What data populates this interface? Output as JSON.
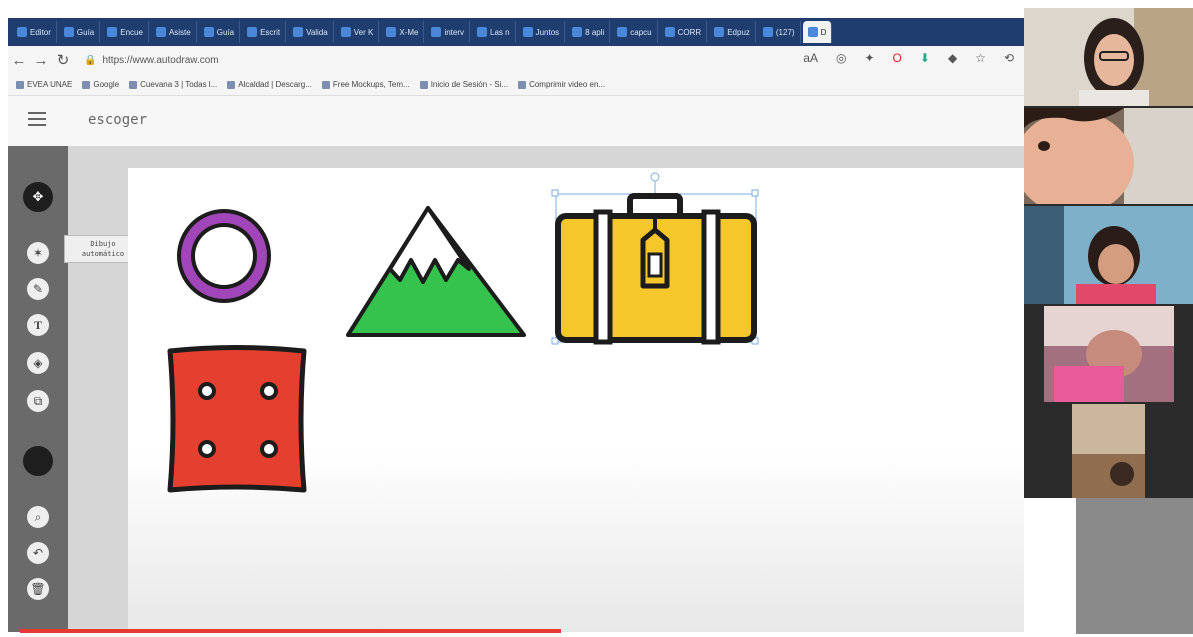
{
  "browser": {
    "tabs": [
      {
        "label": "Editor"
      },
      {
        "label": "Guía"
      },
      {
        "label": "Encue"
      },
      {
        "label": "Asiste"
      },
      {
        "label": "Guía"
      },
      {
        "label": "Escrit"
      },
      {
        "label": "Valida"
      },
      {
        "label": "Ver K"
      },
      {
        "label": "X-Me"
      },
      {
        "label": "interv"
      },
      {
        "label": "Las n"
      },
      {
        "label": "Juntos"
      },
      {
        "label": "8 apli"
      },
      {
        "label": "capcu"
      },
      {
        "label": "CORR"
      },
      {
        "label": "Edpuz"
      },
      {
        "label": "(127)"
      },
      {
        "label": "D"
      }
    ],
    "url": "https://www.autodraw.com",
    "bookmarks": [
      "EVEA UNAE",
      "Google",
      "Cuevana 3 | Todas l...",
      "Alcaldad | Descarg...",
      "Free Mockups, Tem...",
      "Inicio de Sesión - Si...",
      "Comprimir video en..."
    ]
  },
  "app": {
    "title": "escoger",
    "tooltip_line1": "Dibujo",
    "tooltip_line2": "automático",
    "tools": [
      "move-tool",
      "autodraw-tool",
      "draw-tool",
      "text-tool",
      "fill-tool",
      "shape-tool",
      "color-picker",
      "zoom-tool",
      "undo-tool",
      "delete-tool"
    ]
  },
  "canvas": {
    "shapes": [
      "purple-ring",
      "snowy-mountain",
      "yellow-suitcase",
      "red-button"
    ],
    "colors": {
      "ring": "#a146b8",
      "mountain_green": "#35c24d",
      "suitcase_yellow": "#f6c72b",
      "button_red": "#e5402f",
      "outline": "#1c1c1c"
    }
  },
  "video": {
    "participants": [
      "participant-1",
      "participant-2",
      "participant-3",
      "participant-4",
      "participant-5"
    ]
  },
  "player": {
    "progress": 0.47
  }
}
